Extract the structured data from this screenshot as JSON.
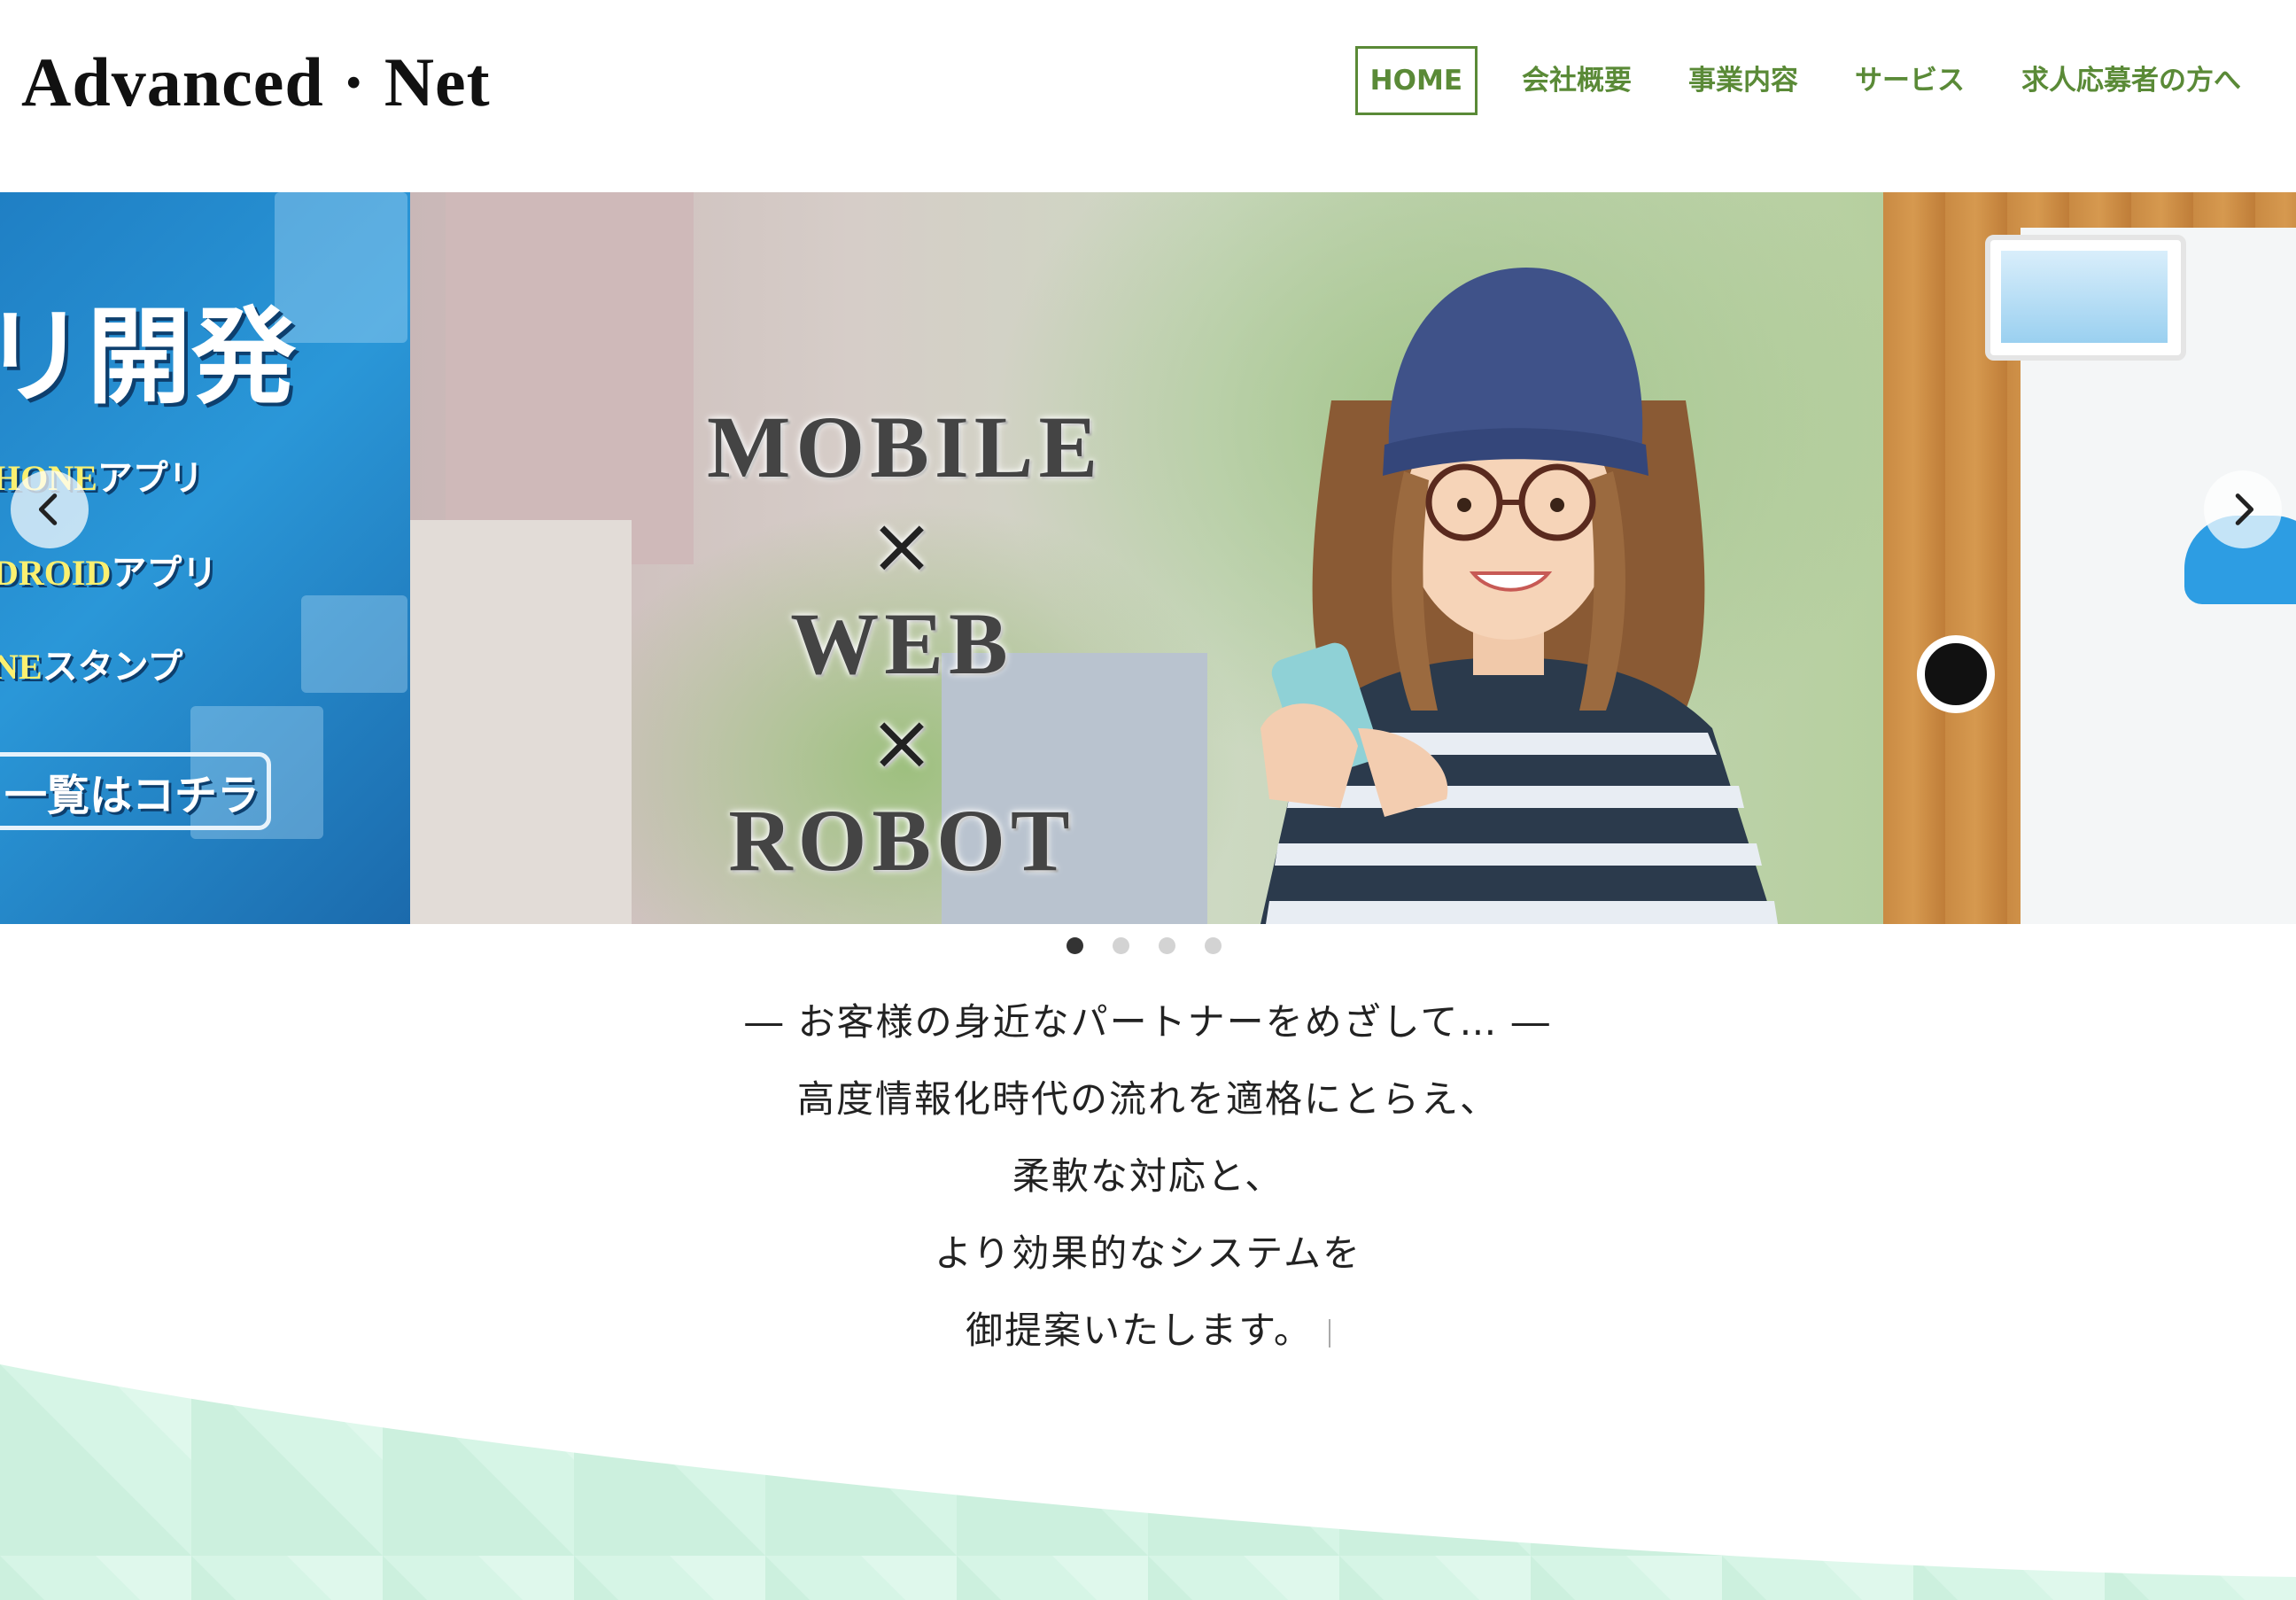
{
  "header": {
    "logo": "Advanced · Net",
    "nav": [
      {
        "label": "HOME",
        "active": true
      },
      {
        "label": "会社概要"
      },
      {
        "label": "事業内容"
      },
      {
        "label": "サービス"
      },
      {
        "label": "求人応募者の方へ"
      }
    ]
  },
  "carousel": {
    "left_slide": {
      "heading": "リ開発",
      "items": [
        {
          "highlight": "HONE",
          "text": "アプリ"
        },
        {
          "highlight": "DROID",
          "text": "アプリ"
        },
        {
          "highlight": "NE",
          "text": "スタンプ"
        }
      ],
      "cta": "一覧はコチラ"
    },
    "main_slide": {
      "words": [
        "MOBILE",
        "×",
        "WEB",
        "×",
        "ROBOT"
      ]
    },
    "prev_icon": "chevron-left-icon",
    "next_icon": "chevron-right-icon",
    "dots": 4,
    "active_dot": 1
  },
  "tagline": {
    "lines": [
      "― お客様の身近なパートナーをめざして… ―",
      "高度情報化時代の流れを適格にとらえ、",
      "柔軟な対応と、",
      "より効果的なシステムを",
      "御提案いたします。"
    ]
  },
  "colors": {
    "nav_green": "#5a8a37",
    "band_mint": "#d6f5e6",
    "slide_blue": "#2a97d8"
  }
}
